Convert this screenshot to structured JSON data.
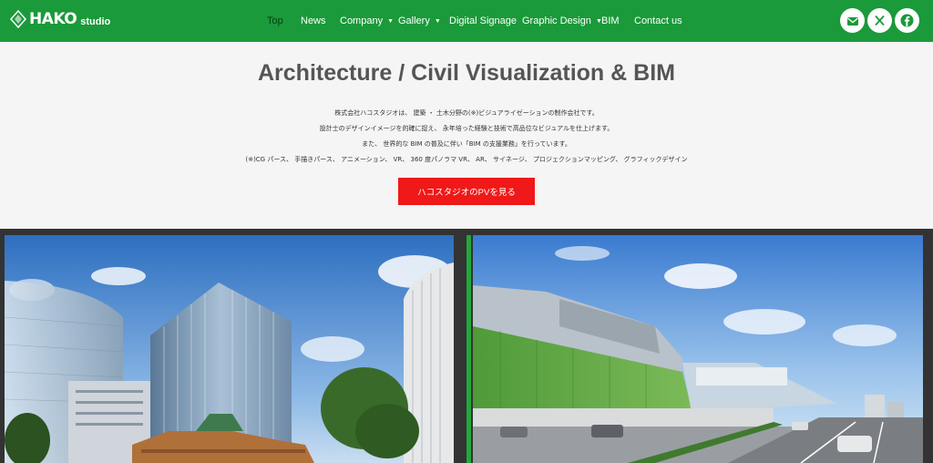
{
  "header": {
    "logo_main": "HAKO",
    "logo_sub": "studio",
    "nav": [
      {
        "label": "Top",
        "active": true,
        "dropdown": false
      },
      {
        "label": "News",
        "active": false,
        "dropdown": false
      },
      {
        "label": "Company",
        "active": false,
        "dropdown": true
      },
      {
        "label": "Gallery",
        "active": false,
        "dropdown": true
      },
      {
        "label": "Digital Signage",
        "active": false,
        "dropdown": false
      },
      {
        "label": "Graphic Design",
        "active": false,
        "dropdown": true
      },
      {
        "label": "BIM",
        "active": false,
        "dropdown": false
      },
      {
        "label": "Contact us",
        "active": false,
        "dropdown": false
      }
    ],
    "social_icons": [
      "mail-icon",
      "x-icon",
      "facebook-icon"
    ]
  },
  "hero": {
    "title": "Architecture / Civil Visualization & BIM",
    "lines": [
      "株式会社ハコスタジオは、 建築 ・ 土木分野の(※)ビジュアライゼーションの制作会社です。",
      "設計士のデザインイメージを的確に捉え、 永年培った経験と技術で高品位なビジュアルを仕上げます。",
      "また、 世界的な BIM の普及に伴い「BIM の支援業務」を行っています。",
      "(※)CG パース、 手描きパース、 アニメーション、 VR、 360 度パノラマ VR、 AR、 サイネージ、 プロジェクションマッピング、 グラフィックデザイン"
    ],
    "button_label": "ハコスタジオのPVを見る"
  },
  "colors": {
    "header_green": "#1a9a3a",
    "button_red": "#f01818",
    "accent_green": "#22a83a"
  }
}
